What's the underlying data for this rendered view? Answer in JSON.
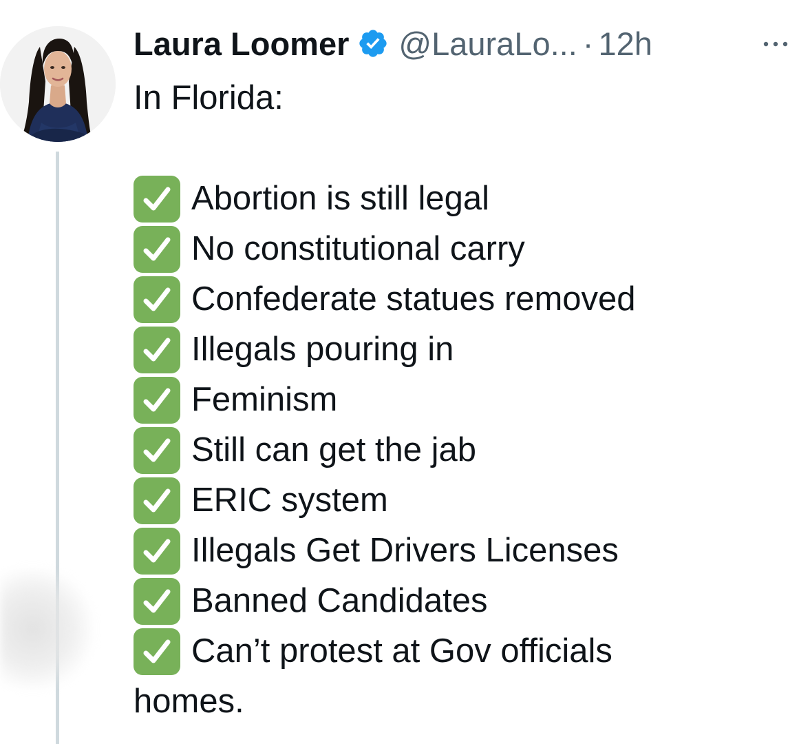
{
  "tweet": {
    "display_name": "Laura Loomer",
    "handle": "@LauraLo...",
    "separator": "·",
    "time": "12h",
    "intro": "In Florida:",
    "items": [
      "Abortion is still legal",
      "No constitutional carry",
      "Confederate statues removed",
      "Illegals pouring in",
      "Feminism",
      "Still can get the jab",
      "ERIC system",
      "Illegals Get Drivers Licenses",
      "Banned Candidates",
      "Can’t protest at Gov officials"
    ],
    "tail": "homes."
  },
  "icons": {
    "verified": "verified-badge-icon",
    "more": "more-options-icon",
    "checkmark": "white-check-mark-emoji"
  },
  "colors": {
    "verified_blue": "#1d9bf0",
    "check_green": "#78b159",
    "secondary_text": "#536471",
    "thread_line": "#cfd9de"
  }
}
